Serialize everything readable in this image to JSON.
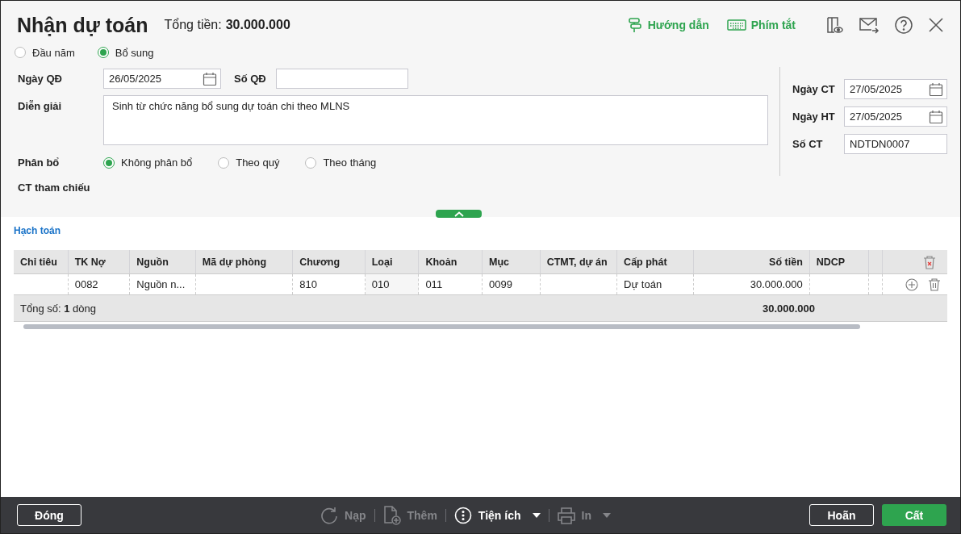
{
  "window": {
    "title": "Nhận dự toán",
    "total_label": "Tổng tiền:",
    "total_value": "30.000.000"
  },
  "header_links": [
    {
      "label": "Hướng dẫn",
      "kind": "guide"
    },
    {
      "label": "Phím tắt",
      "kind": "keyboard"
    }
  ],
  "type_options": [
    {
      "label": "Đầu năm",
      "selected": false
    },
    {
      "label": "Bổ sung",
      "selected": true
    }
  ],
  "form": {
    "ngay_qd_label": "Ngày QĐ",
    "ngay_qd": "26/05/2025",
    "so_qd_label": "Số QĐ",
    "dien_giai_label": "Diễn giải",
    "dien_giai": "Sinh từ chức năng bổ sung dự toán chi theo MLNS",
    "phan_bo_label": "Phân bổ",
    "ct_tham_chieu_label": "CT tham chiếu"
  },
  "phan_bo_options": [
    {
      "label": "Không phân bổ",
      "selected": true
    },
    {
      "label": "Theo quý",
      "selected": false
    },
    {
      "label": "Theo tháng",
      "selected": false
    }
  ],
  "right_fields": [
    {
      "label": "Ngày CT",
      "value": "27/05/2025",
      "kind": "date"
    },
    {
      "label": "Ngày HT",
      "value": "27/05/2025",
      "kind": "date"
    },
    {
      "label": "Số CT",
      "value": "NDTDN0007",
      "kind": "text"
    }
  ],
  "section_title": "Hạch toán",
  "table": {
    "columns": [
      {
        "label": "Chỉ tiêu",
        "kind": "text"
      },
      {
        "label": "TK Nợ",
        "kind": "text"
      },
      {
        "label": "Nguồn",
        "kind": "text"
      },
      {
        "label": "Mã dự phòng",
        "kind": "text"
      },
      {
        "label": "Chương",
        "kind": "text"
      },
      {
        "label": "Loại",
        "kind": "text"
      },
      {
        "label": "Khoản",
        "kind": "text"
      },
      {
        "label": "Mục",
        "kind": "text"
      },
      {
        "label": "CTMT, dự án",
        "kind": "text"
      },
      {
        "label": "Cấp phát",
        "kind": "text"
      },
      {
        "label": "Số tiền",
        "kind": "amount"
      },
      {
        "label": "NDCP",
        "kind": "text"
      }
    ],
    "rows": [
      {
        "cells": [
          "",
          "0082",
          "Nguồn n...",
          "",
          "810",
          "010",
          "011",
          "0099",
          "",
          "Dự toán",
          "30.000.000",
          ""
        ]
      }
    ],
    "footer_label": "Tổng số: **1** dòng",
    "footer_total": "30.000.000"
  },
  "footer_buttons": [
    {
      "label": "Đóng",
      "kind": "outline"
    }
  ],
  "toolbar": [
    {
      "label": "Nạp",
      "kind": "reload",
      "disabled": true,
      "dropdown": false
    },
    {
      "label": "Thêm",
      "kind": "add",
      "disabled": true,
      "dropdown": false
    },
    {
      "label": "Tiện ích",
      "kind": "more",
      "disabled": false,
      "dropdown": true
    },
    {
      "label": "In",
      "kind": "print",
      "disabled": true,
      "dropdown": true
    }
  ],
  "actions": [
    {
      "label": "Hoãn",
      "kind": "outline"
    },
    {
      "label": "Cất",
      "kind": "primary"
    }
  ]
}
